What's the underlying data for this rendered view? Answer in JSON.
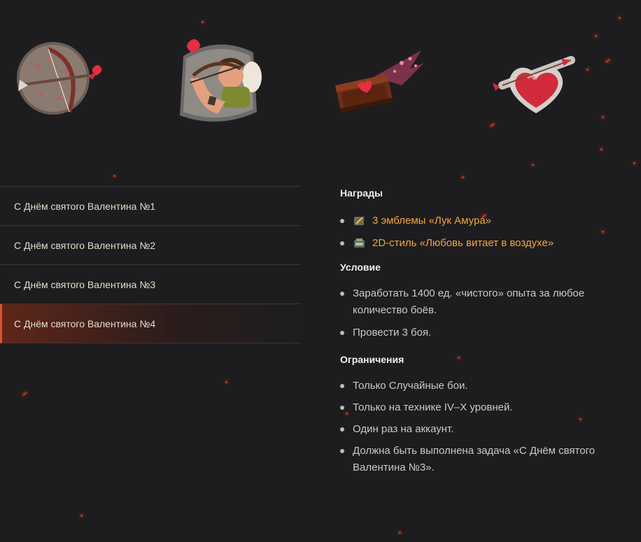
{
  "icons": [
    {
      "name": "cupid-bow-emblem-icon"
    },
    {
      "name": "cupid-archer-emblem-icon"
    },
    {
      "name": "flying-heart-box-icon"
    },
    {
      "name": "heart-arrow-decal-icon"
    }
  ],
  "missions": [
    {
      "label": "С Днём святого Валентина №1",
      "active": false
    },
    {
      "label": "С Днём святого Валентина №2",
      "active": false
    },
    {
      "label": "С Днём святого Валентина №3",
      "active": false
    },
    {
      "label": "С Днём святого Валентина №4",
      "active": true
    }
  ],
  "rewards": {
    "title": "Награды",
    "items": [
      {
        "label": "3 эмблемы «Лук Амура»",
        "icon": "emblem-icon"
      },
      {
        "label": "2D-стиль «Любовь витает в воздухе»",
        "icon": "style-icon"
      }
    ]
  },
  "condition": {
    "title": "Условие",
    "items": [
      "Заработать 1400 ед. «чистого» опыта за любое количество боёв.",
      "Провести 3 боя."
    ]
  },
  "restrictions": {
    "title": "Ограничения",
    "items": [
      "Только Случайные бои.",
      "Только на технике IV–X уровней.",
      "Один раз на аккаунт.",
      "Должна быть выполнена задача «С Днём святого Валентина №3»."
    ]
  },
  "colors": {
    "background": "#1d1d1f",
    "accent": "#d9552b",
    "reward_link": "#f0a53d"
  }
}
